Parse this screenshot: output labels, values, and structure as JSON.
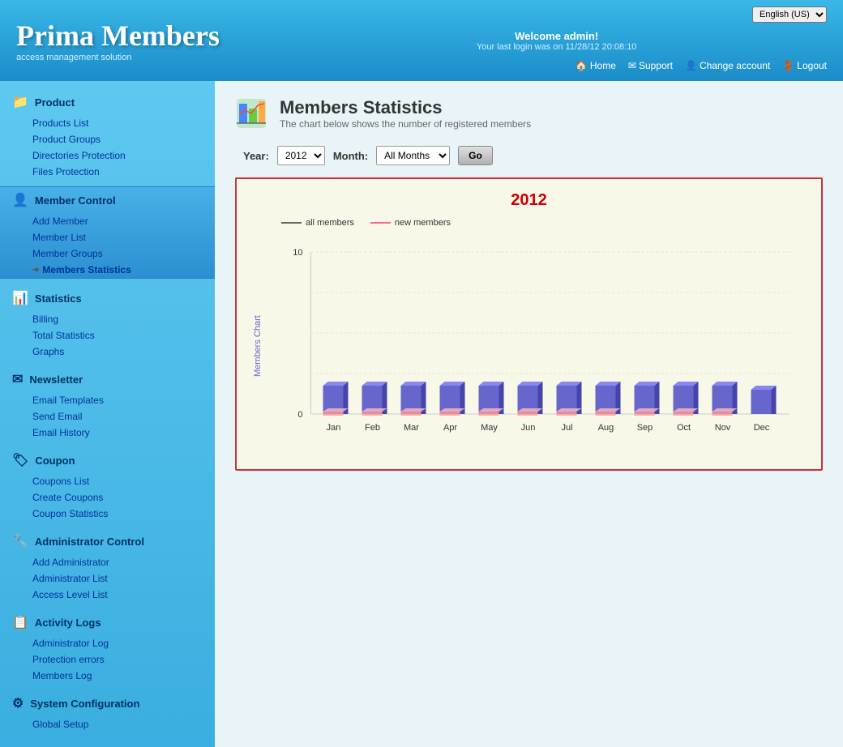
{
  "app": {
    "title": "Prima Members",
    "subtitle": "access management solution",
    "language": "English (US)"
  },
  "header": {
    "welcome": "Welcome admin!",
    "last_login": "Your last login was on 11/28/12 20:08:10",
    "home_label": "Home",
    "support_label": "Support",
    "change_account_label": "Change account",
    "logout_label": "Logout"
  },
  "sidebar": {
    "sections": [
      {
        "id": "product",
        "icon": "📁",
        "label": "Product",
        "items": [
          {
            "id": "products-list",
            "label": "Products List"
          },
          {
            "id": "product-groups",
            "label": "Product Groups"
          },
          {
            "id": "directories-protection",
            "label": "Directories Protection"
          },
          {
            "id": "files-protection",
            "label": "Files Protection"
          }
        ]
      },
      {
        "id": "member-control",
        "icon": "👤",
        "label": "Member Control",
        "active": true,
        "items": [
          {
            "id": "add-member",
            "label": "Add Member"
          },
          {
            "id": "member-list",
            "label": "Member List"
          },
          {
            "id": "member-groups",
            "label": "Member Groups"
          },
          {
            "id": "members-statistics",
            "label": "Members Statistics",
            "current": true
          }
        ]
      },
      {
        "id": "statistics",
        "icon": "📊",
        "label": "Statistics",
        "items": [
          {
            "id": "billing",
            "label": "Billing"
          },
          {
            "id": "total-statistics",
            "label": "Total Statistics"
          },
          {
            "id": "graphs",
            "label": "Graphs"
          }
        ]
      },
      {
        "id": "newsletter",
        "icon": "✉",
        "label": "Newsletter",
        "items": [
          {
            "id": "email-templates",
            "label": "Email Templates"
          },
          {
            "id": "send-email",
            "label": "Send Email"
          },
          {
            "id": "email-history",
            "label": "Email History"
          }
        ]
      },
      {
        "id": "coupon",
        "icon": "🏷",
        "label": "Coupon",
        "items": [
          {
            "id": "coupons-list",
            "label": "Coupons List"
          },
          {
            "id": "create-coupons",
            "label": "Create Coupons"
          },
          {
            "id": "coupon-statistics",
            "label": "Coupon Statistics"
          }
        ]
      },
      {
        "id": "administrator-control",
        "icon": "🔧",
        "label": "Administrator Control",
        "items": [
          {
            "id": "add-administrator",
            "label": "Add Administrator"
          },
          {
            "id": "administrator-list",
            "label": "Administrator List"
          },
          {
            "id": "access-level-list",
            "label": "Access Level List"
          }
        ]
      },
      {
        "id": "activity-logs",
        "icon": "📋",
        "label": "Activity Logs",
        "items": [
          {
            "id": "administrator-log",
            "label": "Administrator Log"
          },
          {
            "id": "protection-errors",
            "label": "Protection errors"
          },
          {
            "id": "members-log",
            "label": "Members Log"
          }
        ]
      },
      {
        "id": "system-configuration",
        "icon": "⚙",
        "label": "System Configuration",
        "items": [
          {
            "id": "global-setup",
            "label": "Global Setup"
          }
        ]
      }
    ]
  },
  "page": {
    "title": "Members Statistics",
    "subtitle": "The chart below shows the number of registered members"
  },
  "chart_controls": {
    "year_label": "Year:",
    "year_value": "2012",
    "month_label": "Month:",
    "month_value": "All Months",
    "go_label": "Go"
  },
  "chart": {
    "year": "2012",
    "legend_all": "all members",
    "legend_new": "new members",
    "y_label": "Members Chart",
    "y_max": 10,
    "y_min": 0,
    "months": [
      "Jan",
      "Feb",
      "Mar",
      "Apr",
      "May",
      "Jun",
      "Jul",
      "Aug",
      "Sep",
      "Oct",
      "Nov",
      "Dec"
    ],
    "all_members": [
      1,
      1,
      1,
      1,
      1,
      1,
      1,
      1,
      1,
      1,
      1,
      1
    ],
    "new_members": [
      1,
      1,
      1,
      1,
      1,
      1,
      1,
      1,
      1,
      1,
      1,
      0
    ]
  }
}
